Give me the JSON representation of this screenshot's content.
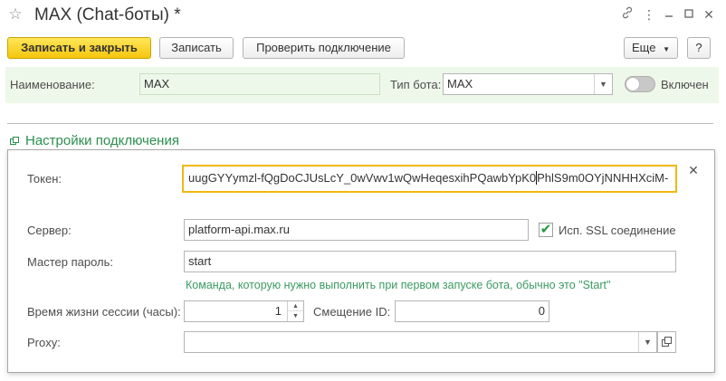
{
  "window": {
    "title": "MAX (Chat-боты) *",
    "icons": [
      "star-icon",
      "link-icon",
      "more-icon",
      "minimize-icon",
      "maximize-icon",
      "close-icon"
    ]
  },
  "toolbar": {
    "save_close_label": "Записать и закрыть",
    "save_label": "Записать",
    "check_label": "Проверить подключение",
    "more_label": "Еще",
    "help_label": "?"
  },
  "header": {
    "name_label": "Наименование:",
    "name_value": "MAX",
    "type_label": "Тип бота:",
    "type_value": "MAX",
    "enabled_label": "Включен",
    "enabled": false
  },
  "connection": {
    "group_title": "Настройки подключения",
    "token_label": "Токен:",
    "token_before_caret": "uugGYYymzl-fQgDoCJUsLcY_0wVwv1wQwHeqesxihPQawbYpK0",
    "token_after_caret": "PhlS9m0OYjNNHHXciM-",
    "server_label": "Сервер:",
    "server_value": "platform-api.max.ru",
    "ssl_label": "Исп. SSL соединение",
    "ssl_checked": true,
    "master_password_label": "Мастер пароль:",
    "master_password_value": "start",
    "master_password_hint": "Команда, которую нужно выполнить при первом запуске бота, обычно это \"Start\"",
    "session_label": "Время жизни сессии (часы):",
    "session_value": "1",
    "offset_label": "Смещение ID:",
    "offset_value": "0",
    "proxy_label": "Proxy:",
    "proxy_value": ""
  },
  "colors": {
    "accent_yellow": "#f5c60e",
    "group_green": "#2b8f4e",
    "header_bg": "#eef8ea",
    "token_border": "#f3b712"
  }
}
